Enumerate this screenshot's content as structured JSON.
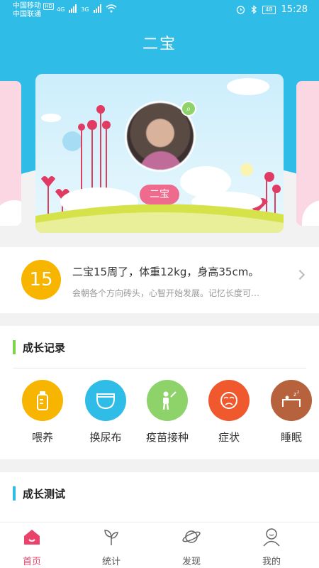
{
  "status_bar": {
    "carrier1": "中国移动",
    "hd": "HD",
    "carrier2": "中国联通",
    "net1": "4G",
    "net2": "3G",
    "battery": "48",
    "time": "15:28"
  },
  "header": {
    "title": "二宝"
  },
  "carousel": {
    "child_name": "二宝"
  },
  "info": {
    "week": "15",
    "title": "二宝15周了，体重12kg，身高35cm。",
    "description": "会朝各个方向砖头，心智开始发展。记忆长度可…"
  },
  "records": {
    "title": "成长记录",
    "items": [
      {
        "label": "喂养",
        "icon": "bottle-icon",
        "color": "#f7b500"
      },
      {
        "label": "换尿布",
        "icon": "diaper-icon",
        "color": "#2fbde8"
      },
      {
        "label": "疫苗接种",
        "icon": "vaccine-icon",
        "color": "#8dd36a"
      },
      {
        "label": "症状",
        "icon": "symptom-icon",
        "color": "#f0592e"
      },
      {
        "label": "睡眠",
        "icon": "sleep-icon",
        "color": "#b5623d"
      }
    ]
  },
  "tests": {
    "title": "成长测试"
  },
  "nav": {
    "items": [
      {
        "label": "首页",
        "icon": "home-icon"
      },
      {
        "label": "统计",
        "icon": "sprout-icon"
      },
      {
        "label": "发现",
        "icon": "planet-icon"
      },
      {
        "label": "我的",
        "icon": "profile-icon"
      }
    ]
  }
}
